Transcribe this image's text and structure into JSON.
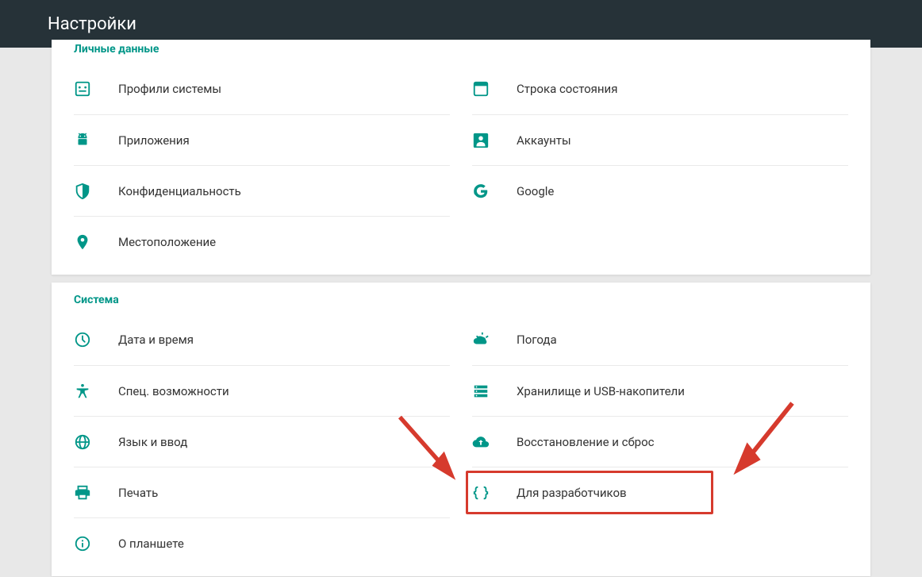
{
  "header": {
    "title": "Настройки"
  },
  "section_personal": {
    "title": "Личные данные",
    "left": [
      {
        "label": "Профили системы",
        "icon": "profiles"
      },
      {
        "label": "Приложения",
        "icon": "android"
      },
      {
        "label": "Конфиденциальность",
        "icon": "shield"
      },
      {
        "label": "Местоположение",
        "icon": "location"
      }
    ],
    "right": [
      {
        "label": "Строка состояния",
        "icon": "statusbar"
      },
      {
        "label": "Аккаунты",
        "icon": "account"
      },
      {
        "label": "Google",
        "icon": "google"
      }
    ]
  },
  "section_system": {
    "title": "Система",
    "left": [
      {
        "label": "Дата и время",
        "icon": "clock"
      },
      {
        "label": "Спец. возможности",
        "icon": "accessibility"
      },
      {
        "label": "Язык и ввод",
        "icon": "globe"
      },
      {
        "label": "Печать",
        "icon": "print"
      },
      {
        "label": "О планшете",
        "icon": "info"
      }
    ],
    "right": [
      {
        "label": "Погода",
        "icon": "weather"
      },
      {
        "label": "Хранилище и USB-накопители",
        "icon": "storage"
      },
      {
        "label": "Восстановление и сброс",
        "icon": "backup"
      },
      {
        "label": "Для разработчиков",
        "icon": "braces",
        "highlighted": true
      }
    ]
  },
  "colors": {
    "accent": "#009688",
    "highlight": "#d63a2d"
  }
}
